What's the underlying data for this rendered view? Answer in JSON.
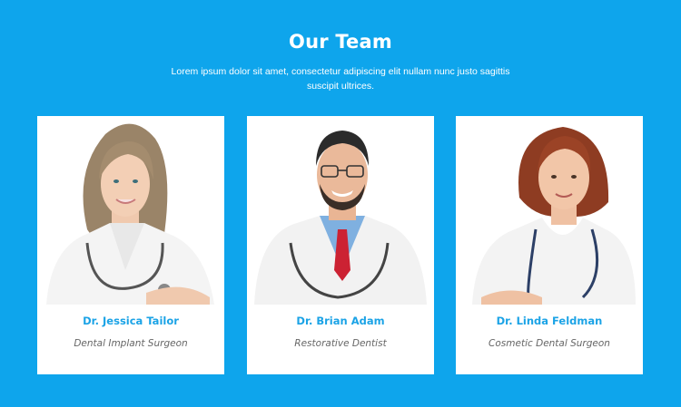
{
  "section": {
    "title": "Our Team",
    "intro": "Lorem ipsum dolor sit amet, consectetur adipiscing elit nullam nunc justo sagittis suscipit ultrices."
  },
  "team": [
    {
      "name": "Dr. Jessica Tailor",
      "role": "Dental Implant Surgeon"
    },
    {
      "name": "Dr. Brian Adam",
      "role": "Restorative Dentist"
    },
    {
      "name": "Dr. Linda Feldman",
      "role": "Cosmetic Dental Surgeon"
    }
  ],
  "colors": {
    "background": "#0ea5ec",
    "card": "#ffffff",
    "name_accent": "#1ba3e6"
  }
}
